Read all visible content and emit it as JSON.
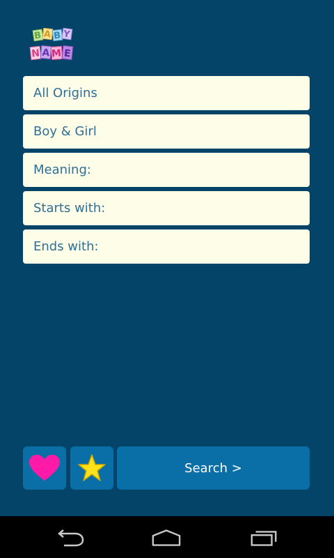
{
  "app": {
    "logo_letters": [
      "B",
      "A",
      "B",
      "Y",
      "N",
      "A",
      "M",
      "E"
    ],
    "logo_icon": "baby-name-blocks-logo"
  },
  "filters": {
    "origin": {
      "value": "All Origins"
    },
    "gender": {
      "value": "Boy & Girl"
    },
    "meaning": {
      "placeholder": "Meaning:"
    },
    "starts_with": {
      "placeholder": "Starts with:"
    },
    "ends_with": {
      "placeholder": "Ends with:"
    }
  },
  "actions": {
    "favorites_icon": "heart-icon",
    "starred_icon": "star-icon",
    "search_label": "Search >"
  },
  "colors": {
    "background": "#034468",
    "field_background": "#fdfde8",
    "field_text": "#2f6f95",
    "button": "#0a6fa6",
    "heart": "#ff1aa8",
    "star": "#ffe21a"
  },
  "navbar": {
    "icons": [
      "back-icon",
      "home-icon",
      "recent-apps-icon"
    ]
  }
}
